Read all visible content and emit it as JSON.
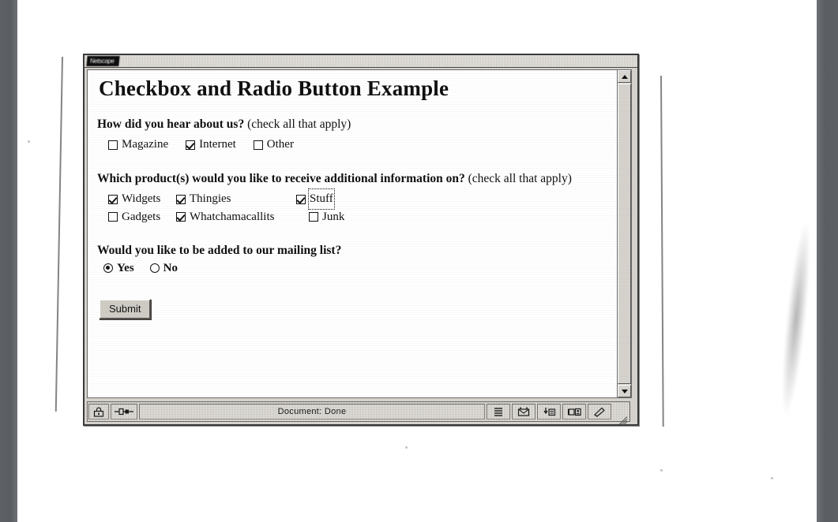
{
  "window": {
    "title_bar_label": "Netscape",
    "scrollbar": {
      "up_arrow": "scroll-up-arrow",
      "down_arrow": "scroll-down-arrow"
    }
  },
  "page": {
    "heading": "Checkbox and Radio Button Example",
    "questions": [
      {
        "id": "hear-about-us",
        "prompt": "How did you hear about us?",
        "hint": "(check all that apply)",
        "rows": [
          [
            {
              "label": "Magazine",
              "type": "checkbox",
              "checked": false,
              "focused": false
            },
            {
              "label": "Internet",
              "type": "checkbox",
              "checked": true,
              "focused": false
            },
            {
              "label": "Other",
              "type": "checkbox",
              "checked": false,
              "focused": false
            }
          ]
        ]
      },
      {
        "id": "product-info",
        "prompt": "Which product(s) would you like to receive additional information on?",
        "hint": "(check all that apply)",
        "rows": [
          [
            {
              "label": "Widgets",
              "type": "checkbox",
              "checked": true,
              "focused": false
            },
            {
              "label": "Thingies",
              "type": "checkbox",
              "checked": true,
              "focused": false
            },
            {
              "label": "Stuff",
              "type": "checkbox",
              "checked": true,
              "focused": true
            }
          ],
          [
            {
              "label": "Gadgets",
              "type": "checkbox",
              "checked": false,
              "focused": false
            },
            {
              "label": "Whatchamacallits",
              "type": "checkbox",
              "checked": true,
              "focused": false
            },
            {
              "label": "Junk",
              "type": "checkbox",
              "checked": false,
              "focused": false
            }
          ]
        ]
      },
      {
        "id": "mailing-list",
        "prompt": "Would you like to be added to our mailing list?",
        "hint": "",
        "inline": true,
        "rows": [
          [
            {
              "label": "Yes",
              "type": "radio",
              "checked": true,
              "focused": false
            },
            {
              "label": "No",
              "type": "radio",
              "checked": false,
              "focused": false
            }
          ]
        ]
      }
    ],
    "submit_label": "Submit"
  },
  "status_bar": {
    "status_text": "Document: Done",
    "security_icon": "padlock-icon",
    "connection_icon": "network-connection-icon",
    "component_icons": [
      "navigator-icon",
      "mailbox-icon",
      "newsgroups-icon",
      "address-book-icon",
      "composer-icon"
    ],
    "resize_grip": "resize-grip"
  },
  "colors": {
    "window_chrome": "#d6d3ce",
    "page_background": "#ffffff",
    "text": "#101010",
    "frame_border": "#3a3a3a"
  }
}
